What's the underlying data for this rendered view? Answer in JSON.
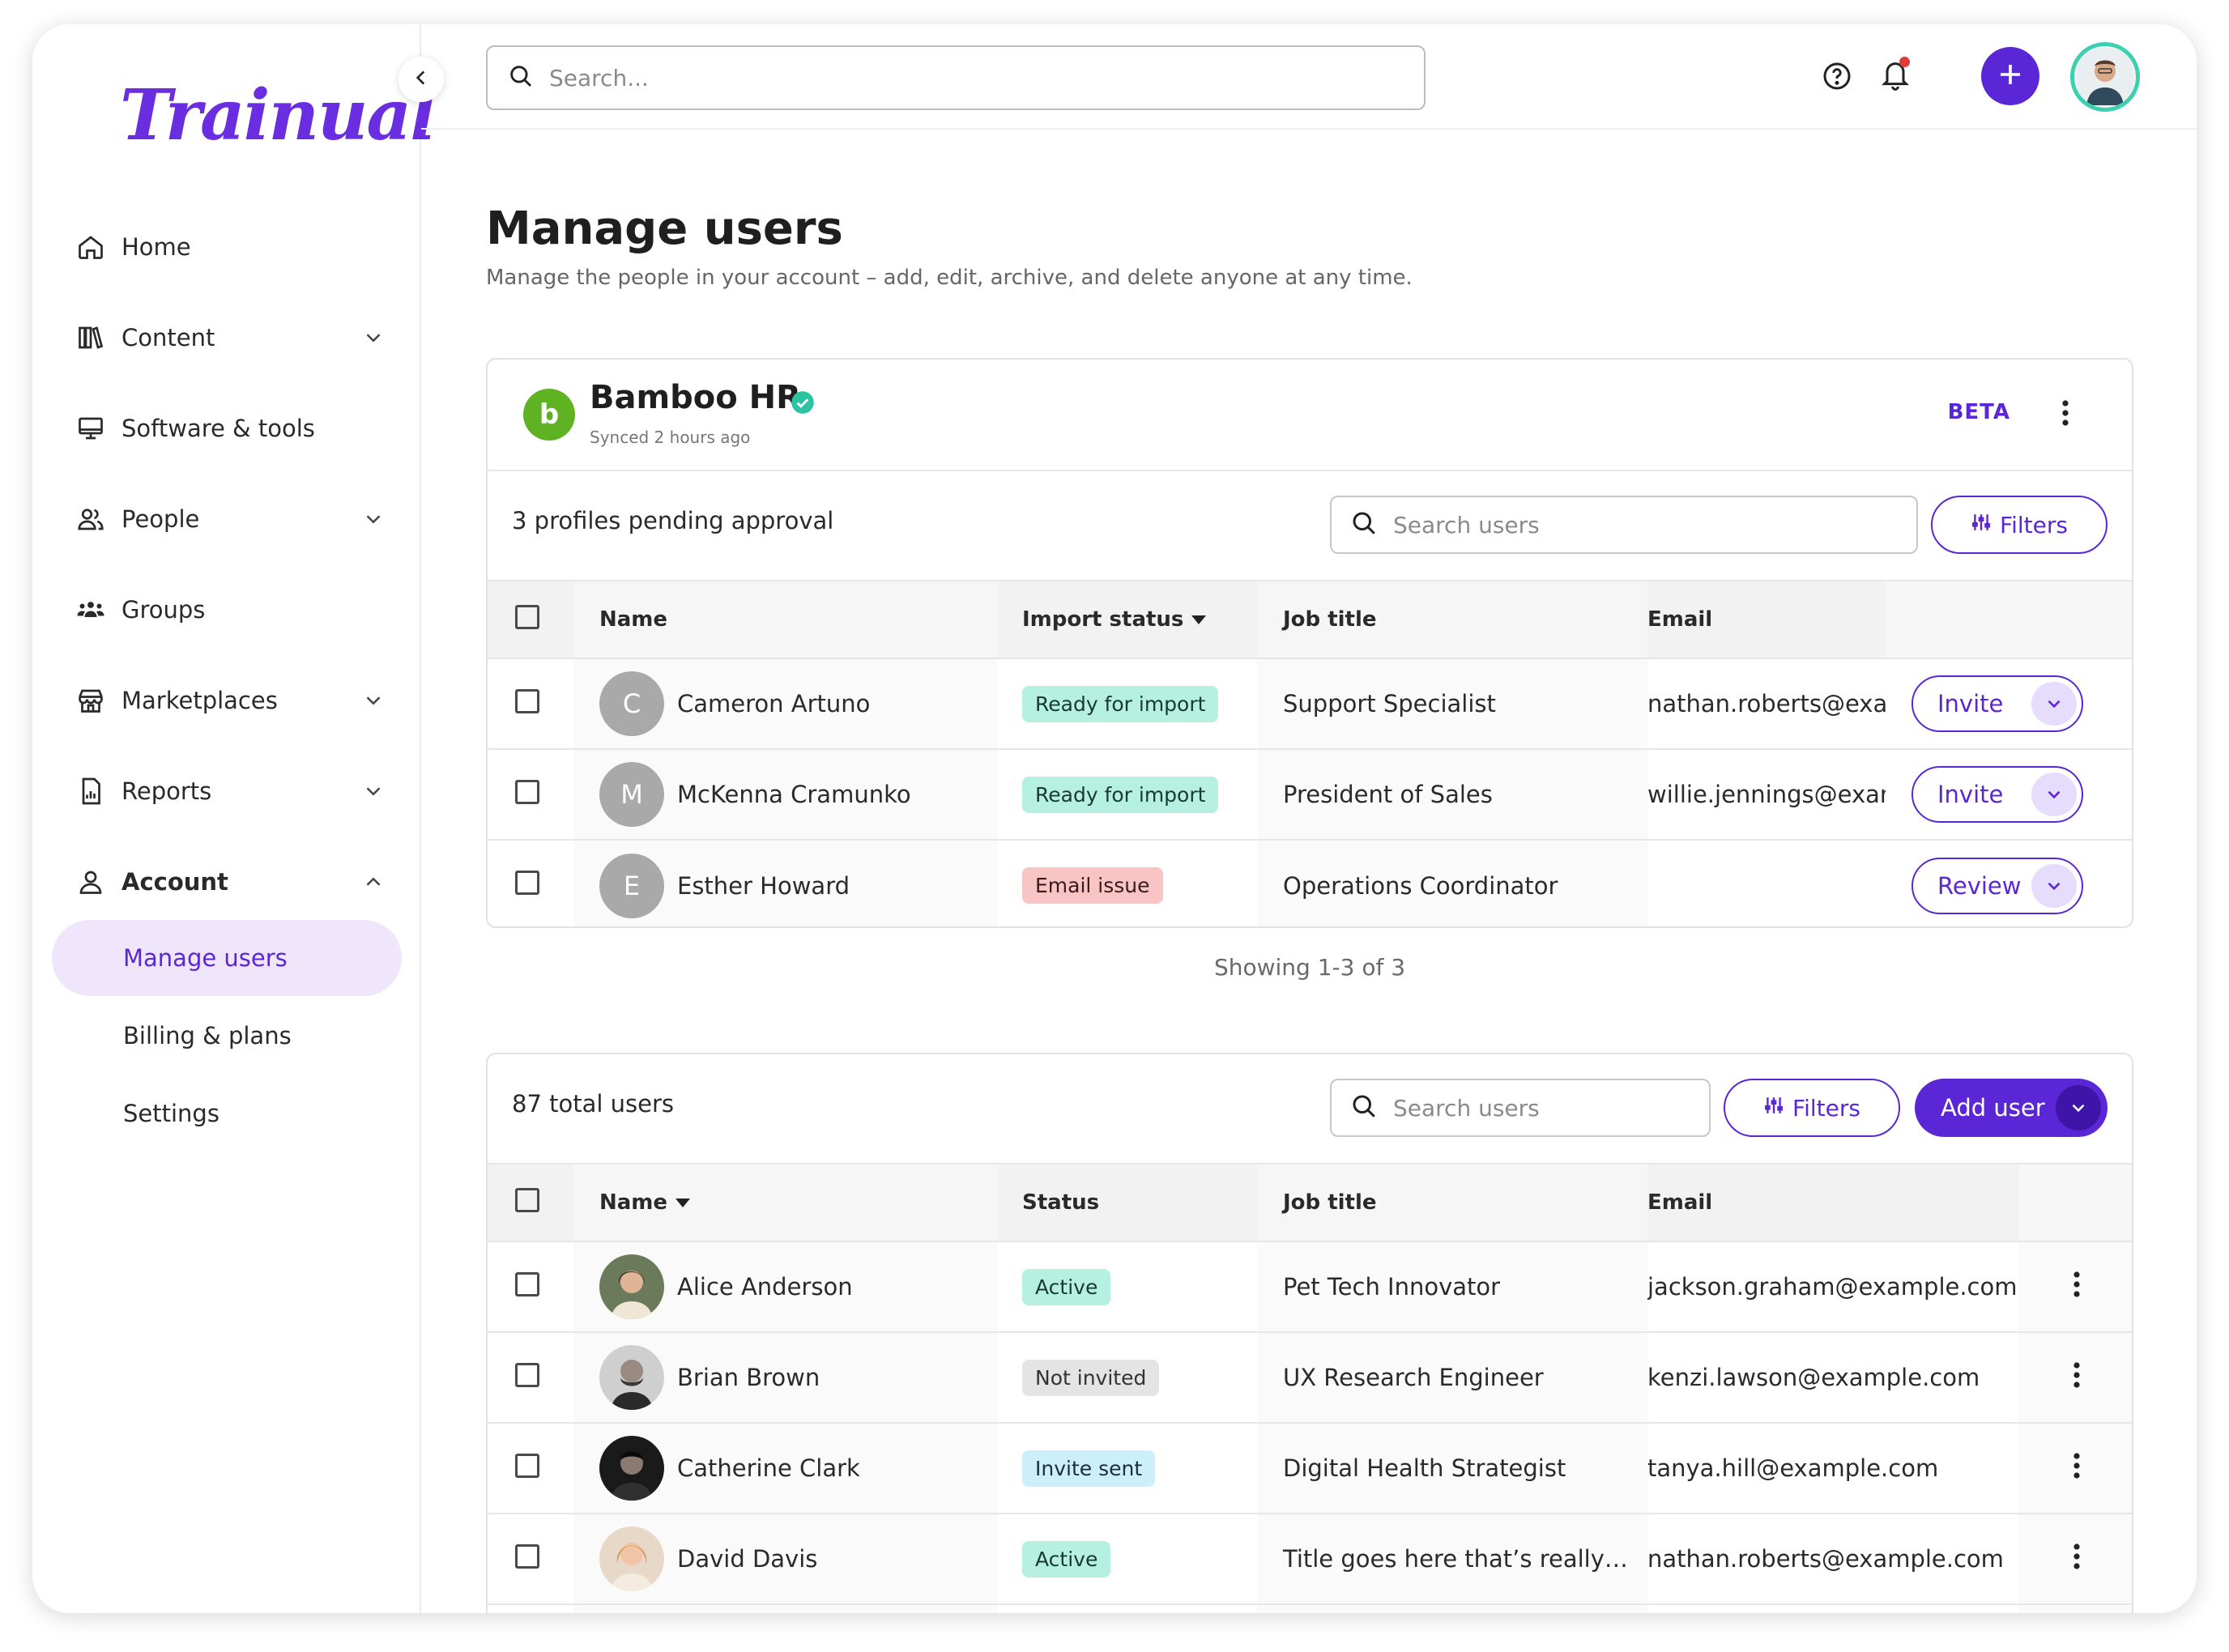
{
  "app": {
    "logo_text": "Trainual",
    "accent": "#5b26d6"
  },
  "sidebar": {
    "items": [
      {
        "label": "Home",
        "icon": "home-icon"
      },
      {
        "label": "Content",
        "icon": "books-icon"
      },
      {
        "label": "Software & tools",
        "icon": "monitor-icon"
      },
      {
        "label": "People",
        "icon": "people-icon"
      },
      {
        "label": "Groups",
        "icon": "groups-icon"
      },
      {
        "label": "Marketplaces",
        "icon": "storefront-icon"
      },
      {
        "label": "Reports",
        "icon": "report-icon"
      },
      {
        "label": "Account",
        "icon": "user-icon"
      }
    ],
    "sub_items": [
      {
        "label": "Manage users",
        "active": true
      },
      {
        "label": "Billing & plans"
      },
      {
        "label": "Settings"
      }
    ]
  },
  "topbar": {
    "search_placeholder": "Search..."
  },
  "page": {
    "title": "Manage users",
    "subtitle": "Manage the people in your account – add, edit, archive, and delete anyone at any time."
  },
  "bamboo": {
    "name": "Bamboo HR",
    "synced": "Synced 2 hours ago",
    "beta": "BETA",
    "pending_count": "3 profiles pending approval",
    "search_placeholder": "Search users",
    "filters_label": "Filters",
    "columns": {
      "name": "Name",
      "status": "Import status",
      "job": "Job title",
      "email": "Email"
    },
    "rows": [
      {
        "initial": "C",
        "name": "Cameron Artuno",
        "status": "Ready for import",
        "job": "Support Specialist",
        "email": "nathan.roberts@example.com",
        "action": "Invite"
      },
      {
        "initial": "M",
        "name": "McKenna Cramunko",
        "status": "Ready for import",
        "job": "President of Sales",
        "email": "willie.jennings@example.com",
        "action": "Invite"
      },
      {
        "initial": "E",
        "name": "Esther Howard",
        "status": "Email issue",
        "job": "Operations Coordinator",
        "email": "",
        "action": "Review"
      }
    ],
    "showing": "Showing  1-3 of 3"
  },
  "users": {
    "total": "87 total users",
    "search_placeholder": "Search users",
    "filters_label": "Filters",
    "add_label": "Add user",
    "columns": {
      "name": "Name",
      "status": "Status",
      "job": "Job title",
      "email": "Email"
    },
    "rows": [
      {
        "name": "Alice Anderson",
        "status": "Active",
        "job": "Pet Tech Innovator",
        "email": "jackson.graham@example.com"
      },
      {
        "name": "Brian Brown",
        "status": "Not invited",
        "job": "UX Research Engineer",
        "email": "kenzi.lawson@example.com"
      },
      {
        "name": "Catherine Clark",
        "status": "Invite sent",
        "job": "Digital Health Strategist",
        "email": "tanya.hill@example.com"
      },
      {
        "name": "David Davis",
        "status": "Active",
        "job": "Title goes here that’s really…",
        "email": "nathan.roberts@example.com"
      }
    ]
  }
}
